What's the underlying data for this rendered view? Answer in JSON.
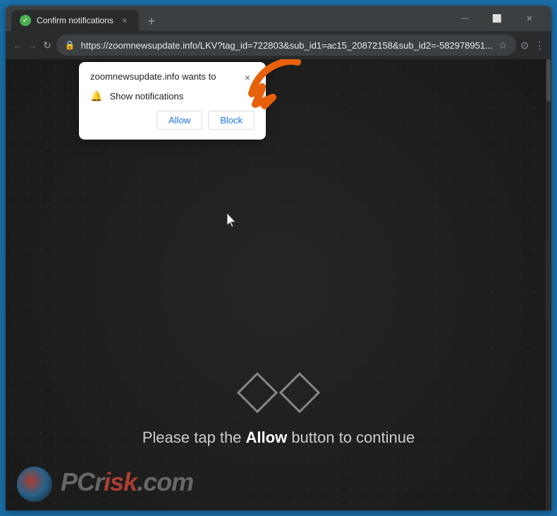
{
  "browser": {
    "tab": {
      "favicon_color": "#4caf50",
      "title": "Confirm notifications",
      "close_symbol": "×"
    },
    "new_tab_symbol": "+",
    "window_controls": {
      "minimize": "—",
      "maximize": "⬜",
      "close": "✕"
    },
    "nav": {
      "back_symbol": "←",
      "forward_symbol": "→",
      "refresh_symbol": "↻",
      "url": "https://zoomnewsupdate.info/LKV?tag_id=722803&sub_id1=ac15_20872158&sub_id2=-582978951...",
      "star_symbol": "☆",
      "profile_symbol": "⊙",
      "menu_symbol": "⋮"
    }
  },
  "notification_popup": {
    "title": "zoomnewsupdate.info wants to",
    "close_symbol": "×",
    "permission_text": "Show notifications",
    "allow_label": "Allow",
    "block_label": "Block"
  },
  "page": {
    "message_prefix": "Please tap the ",
    "message_bold": "Allow",
    "message_suffix": " button to continue"
  },
  "watermark": {
    "text_gray": "r",
    "text_red": "isk.com",
    "full_text": "risk.com"
  },
  "colors": {
    "browser_bg": "#3c3f41",
    "tab_active": "#292b2d",
    "nav_bg": "#292b2d",
    "page_bg": "#1a1a1a",
    "popup_bg": "#ffffff",
    "allow_color": "#1a73e8",
    "block_color": "#1a73e8",
    "accent_blue": "#1a6ea8",
    "orange_arrow": "#e8610a"
  }
}
